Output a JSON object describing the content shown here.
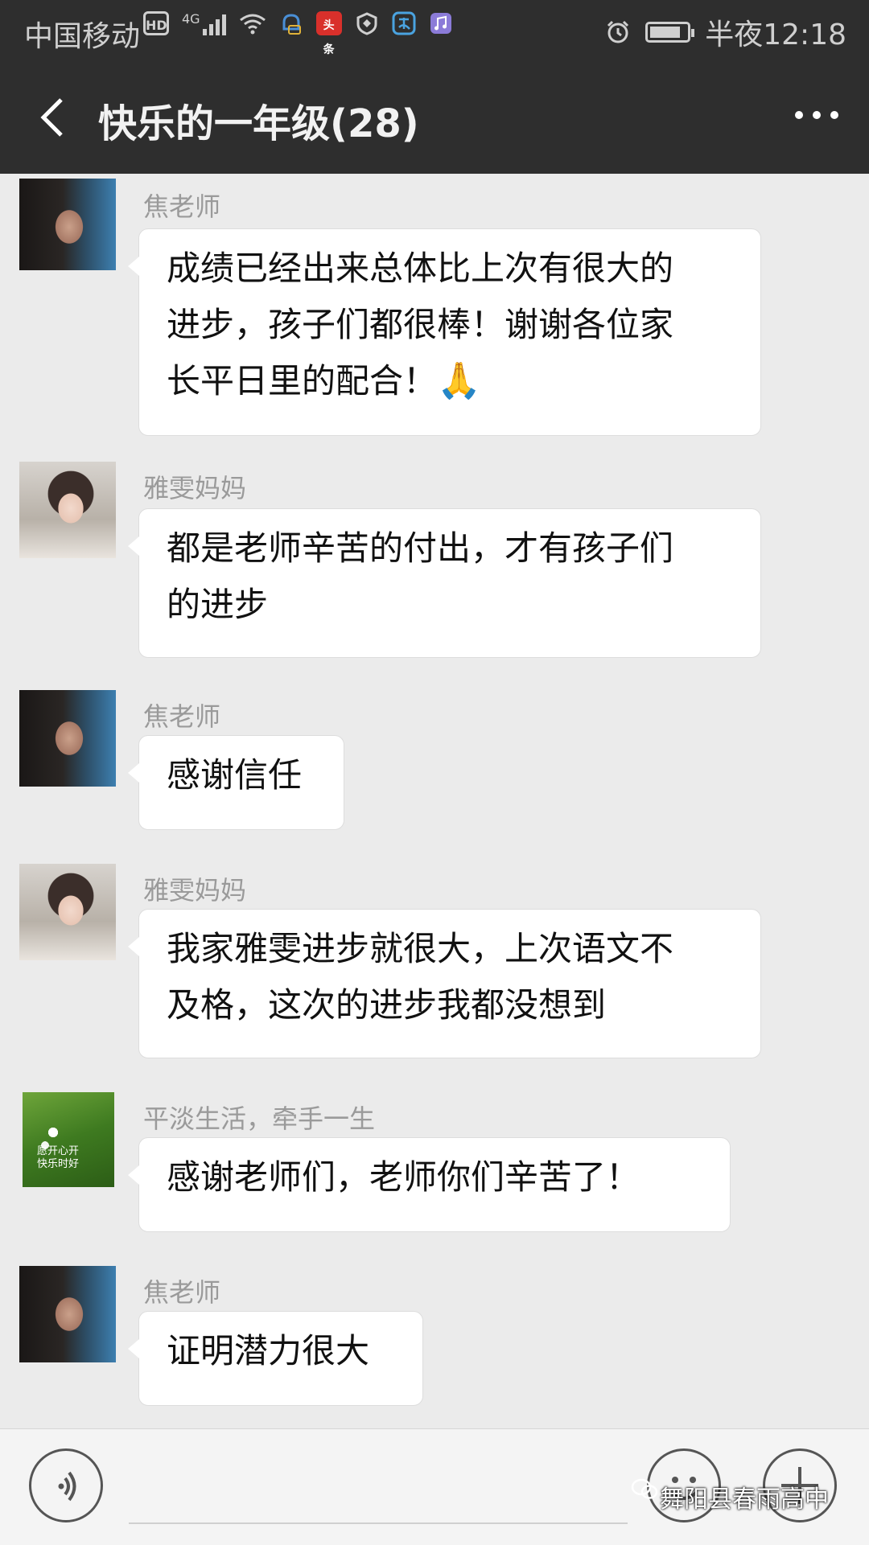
{
  "status_bar": {
    "carrier": "中国移动",
    "hd_badge": "HD",
    "network": "4G",
    "app_badge": "头条",
    "time": "半夜12:18",
    "icons": [
      "hd-icon",
      "signal-icon",
      "wifi-icon",
      "notification-icon",
      "toutiao-icon",
      "shield-icon",
      "alipay-icon",
      "music-icon",
      "alarm-icon",
      "battery-icon"
    ],
    "battery_level": 0.85
  },
  "header": {
    "title": "快乐的一年级(28)",
    "back_icon": "back-chevron-icon",
    "more_icon": "more-dots-icon"
  },
  "messages": [
    {
      "sender": "焦老师",
      "avatar": "teacher",
      "text": "成绩已经出来总体比上次有很大的\n进步，孩子们都很棒！谢谢各位家\n长平日里的配合！",
      "emoji": "🙏"
    },
    {
      "sender": "雅雯妈妈",
      "avatar": "mom",
      "text": "都是老师辛苦的付出，才有孩子们\n的进步"
    },
    {
      "sender": "焦老师",
      "avatar": "teacher",
      "text": "感谢信任"
    },
    {
      "sender": "雅雯妈妈",
      "avatar": "mom",
      "text": "我家雅雯进步就很大，上次语文不\n及格，这次的进步我都没想到"
    },
    {
      "sender": "平淡生活，牵手一生",
      "avatar": "flower",
      "avatar_text": "愿开心开\n快乐时好",
      "text": "感谢老师们，老师你们辛苦了！"
    },
    {
      "sender": "焦老师",
      "avatar": "teacher",
      "text": "证明潜力很大"
    }
  ],
  "input_bar": {
    "voice_icon": "voice-icon",
    "emoji_icon": "emoji-face-icon",
    "plus_icon": "plus-icon",
    "watermark": "舞阳县春雨高中"
  },
  "colors": {
    "header_bg": "#2e2e2e",
    "chat_bg": "#ebebeb",
    "bubble_bg": "#ffffff",
    "sender_text": "#9a9a9a"
  }
}
